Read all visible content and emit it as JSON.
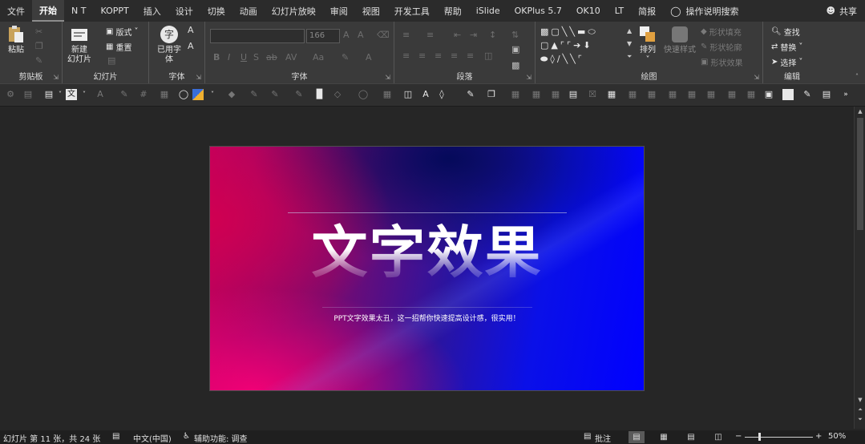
{
  "tabs": [
    "文件",
    "开始",
    "N T",
    "KOPPT",
    "插入",
    "设计",
    "切换",
    "动画",
    "幻灯片放映",
    "审阅",
    "视图",
    "开发工具",
    "帮助",
    "iSlide",
    "OKPlus 5.7",
    "OK10",
    "LT",
    "简报"
  ],
  "tell_me": "操作说明搜索",
  "share": "共享",
  "ribbon": {
    "clipboard": {
      "label": "剪贴板",
      "paste": "粘贴"
    },
    "slides": {
      "label": "幻灯片",
      "new_slide_1": "新建",
      "new_slide_2": "幻灯片",
      "layout": "版式",
      "reset": "重置"
    },
    "font_small": {
      "label": "字体",
      "common_1": "已用字",
      "common_2": "体"
    },
    "font": {
      "label": "字体",
      "size": "166"
    },
    "paragraph": {
      "label": "段落"
    },
    "drawing": {
      "label": "绘图",
      "arrange": "排列",
      "quick_styles": "快速样式",
      "shape_fill": "形状填充",
      "shape_outline": "形状轮廓",
      "shape_effects": "形状效果"
    },
    "editing": {
      "label": "编辑",
      "find": "查找",
      "replace": "替换",
      "select": "选择"
    }
  },
  "slide": {
    "title": "文字效果",
    "subtitle": "PPT文字效果太丑，这一招帮你快速提高设计感，很实用！"
  },
  "status": {
    "slide_info": "幻灯片 第 11 张，共 24 张",
    "language": "中文(中国)",
    "accessibility": "辅助功能: 调查",
    "notes": "批注",
    "zoom": "50%",
    "zoom_minus": "−",
    "zoom_plus": "+"
  }
}
